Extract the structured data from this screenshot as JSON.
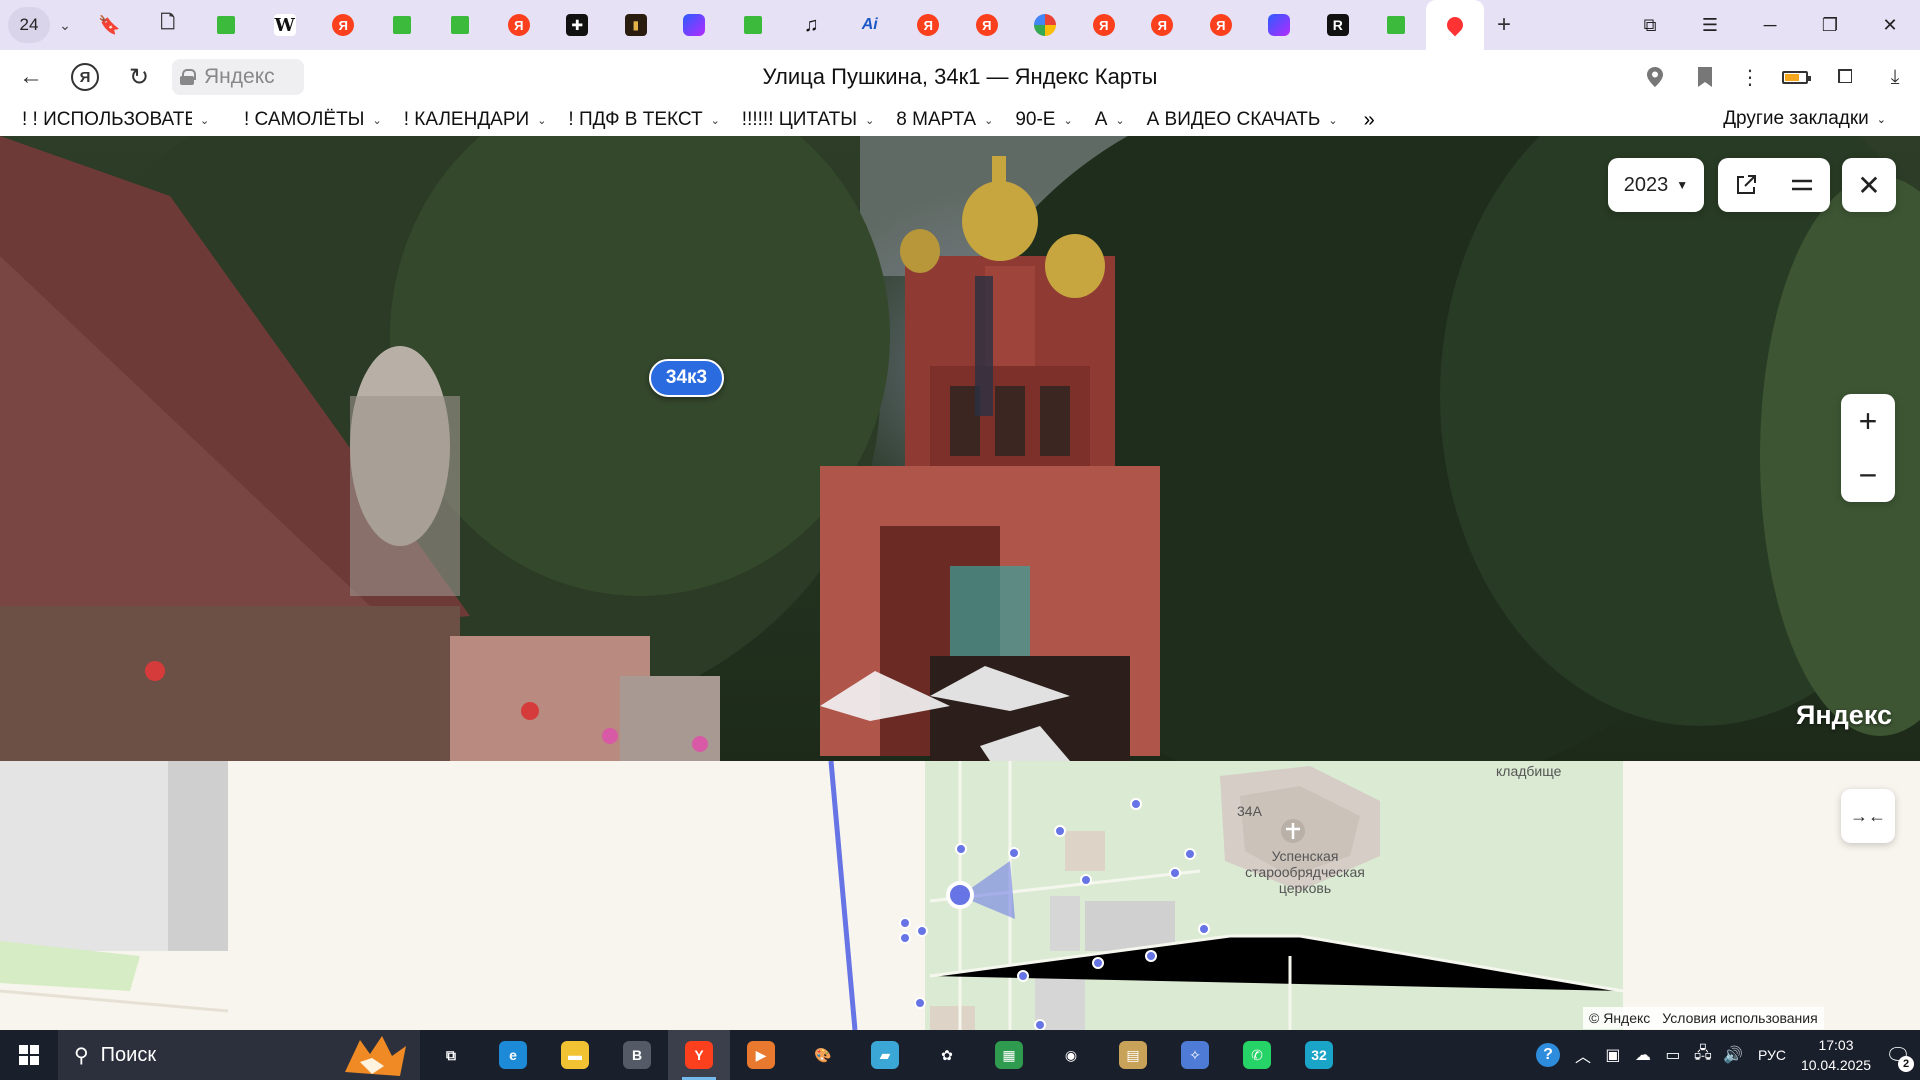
{
  "browser": {
    "tab_counter": "24",
    "tabs": [
      {
        "icon": "bookmark-icon",
        "glyph": "🔖"
      },
      {
        "icon": "document-icon",
        "glyph": "🗋"
      },
      {
        "icon": "green-square-icon",
        "glyph": ""
      },
      {
        "icon": "wikipedia-icon",
        "glyph": "W"
      },
      {
        "icon": "yandex-icon",
        "glyph": "Я"
      },
      {
        "icon": "green-square-icon",
        "glyph": ""
      },
      {
        "icon": "green-square-icon",
        "glyph": ""
      },
      {
        "icon": "yandex-icon",
        "glyph": "Я"
      },
      {
        "icon": "plus-dark-icon",
        "glyph": "✚"
      },
      {
        "icon": "book-icon",
        "glyph": "▮"
      },
      {
        "icon": "gradient-app-icon",
        "glyph": ""
      },
      {
        "icon": "green-square-icon",
        "glyph": ""
      },
      {
        "icon": "music-note-icon",
        "glyph": "♫"
      },
      {
        "icon": "ai-app-icon",
        "glyph": "Ai"
      },
      {
        "icon": "yandex-icon",
        "glyph": "Я"
      },
      {
        "icon": "yandex-icon",
        "glyph": "Я"
      },
      {
        "icon": "google-lens-icon",
        "glyph": ""
      },
      {
        "icon": "yandex-icon",
        "glyph": "Я"
      },
      {
        "icon": "yandex-icon",
        "glyph": "Я"
      },
      {
        "icon": "yandex-icon",
        "glyph": "Я"
      },
      {
        "icon": "gradient-app-icon",
        "glyph": ""
      },
      {
        "icon": "r-app-icon",
        "glyph": "R"
      },
      {
        "icon": "green-square-icon",
        "glyph": ""
      },
      {
        "icon": "map-pin-icon",
        "glyph": "",
        "active": true
      }
    ],
    "url_host": "Яндекс",
    "page_title": "Улица Пушкина, 34к1 — Яндекс Карты"
  },
  "bookmarks": {
    "items": [
      "! ! ИСПОЛЬЗОВАТЕ",
      "! САМОЛЁТЫ",
      "! КАЛЕНДАРИ",
      "! ПДФ В ТЕКСТ",
      "!!!!!! ЦИТАТЫ",
      "8 МАРТА",
      "90-Е",
      "А",
      "А ВИДЕО СКАЧАТЬ"
    ],
    "more": "»",
    "other": "Другие закладки"
  },
  "streetview": {
    "building_badge": "34к3",
    "year": "2023",
    "watermark": "Яндекс"
  },
  "map": {
    "labels": {
      "cemetery": "кладбище",
      "house_number": "34А",
      "church": "Успенская\nстарообрядческая\nцерковь"
    },
    "copyright": "© Яндекс",
    "terms": "Условия использования"
  },
  "taskbar": {
    "search_placeholder": "Поиск",
    "apps": [
      {
        "name": "task-view",
        "glyph": "⧉",
        "color": "transparent"
      },
      {
        "name": "edge",
        "glyph": "e",
        "color": "#1c8ad6"
      },
      {
        "name": "file-explorer",
        "glyph": "▬",
        "color": "#f1c232"
      },
      {
        "name": "app-b",
        "glyph": "B",
        "color": "#555b66"
      },
      {
        "name": "yandex-browser",
        "glyph": "Y",
        "color": "#fc3f1d",
        "active": true
      },
      {
        "name": "media-player",
        "glyph": "▶",
        "color": "#e8792e"
      },
      {
        "name": "paint",
        "glyph": "🎨",
        "color": "transparent"
      },
      {
        "name": "notes",
        "glyph": "▰",
        "color": "#3aa7d6"
      },
      {
        "name": "settings-app",
        "glyph": "✿",
        "color": "transparent"
      },
      {
        "name": "dashboard",
        "glyph": "▦",
        "color": "#2e9b4e"
      },
      {
        "name": "camera",
        "glyph": "◉",
        "color": "transparent"
      },
      {
        "name": "scanner",
        "glyph": "▤",
        "color": "#c9a25a"
      },
      {
        "name": "tools",
        "glyph": "✧",
        "color": "#4d7bd6"
      },
      {
        "name": "whatsapp",
        "glyph": "✆",
        "color": "#25d366"
      },
      {
        "name": "app-32",
        "glyph": "32",
        "color": "#1aa4c8"
      }
    ],
    "language": "РУС",
    "time": "17:03",
    "date": "10.04.2025",
    "notifications": "2"
  },
  "colors": {
    "accent": "#2a6be0",
    "tab_strip": "#e6e1f5",
    "taskbar": "#1a1f2c",
    "map_green": "#dbead2",
    "track_blue": "#6674e6"
  }
}
